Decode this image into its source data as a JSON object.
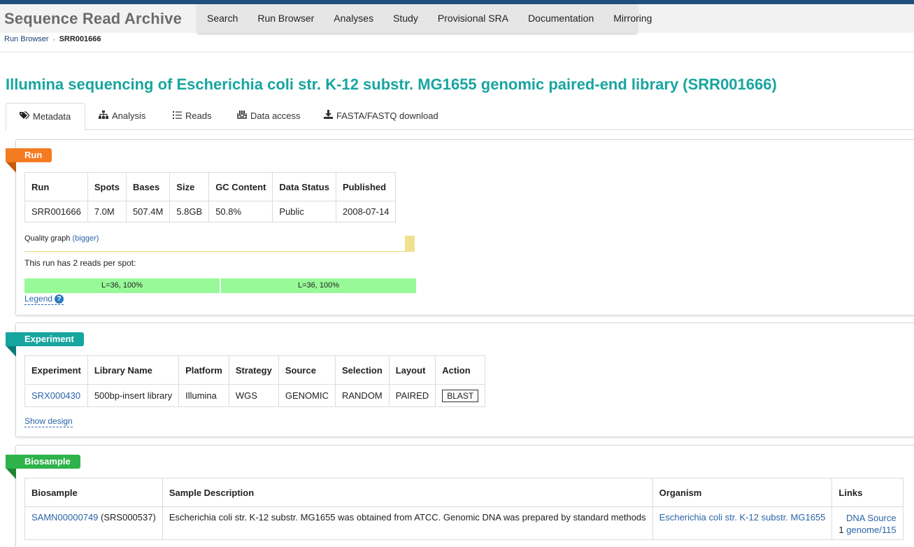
{
  "header": {
    "brand": "Sequence Read Archive",
    "nav": [
      "Search",
      "Run Browser",
      "Analyses",
      "Study",
      "Provisional SRA",
      "Documentation",
      "Mirroring"
    ]
  },
  "breadcrumb": {
    "link": "Run Browser",
    "current": "SRR001666"
  },
  "page_title": "Illumina sequencing of Escherichia coli str. K-12 substr. MG1655 genomic paired-end library (SRR001666)",
  "tabs": [
    {
      "label": "Metadata",
      "icon": "tags-icon"
    },
    {
      "label": "Analysis",
      "icon": "sitemap-icon"
    },
    {
      "label": "Reads",
      "icon": "list-icon"
    },
    {
      "label": "Data access",
      "icon": "inbox-icon"
    },
    {
      "label": "FASTA/FASTQ download",
      "icon": "download-icon"
    }
  ],
  "run": {
    "label": "Run",
    "color": "#f57b20",
    "headers": [
      "Run",
      "Spots",
      "Bases",
      "Size",
      "GC Content",
      "Data Status",
      "Published"
    ],
    "row": [
      "SRR001666",
      "7.0M",
      "507.4M",
      "5.8GB",
      "50.8%",
      "Public",
      "2008-07-14"
    ],
    "quality_label": "Quality graph",
    "quality_link": "(bigger)",
    "reads_text": "This run has 2 reads per spot:",
    "reads": [
      "L=36, 100%",
      "L=36, 100%"
    ],
    "legend": "Legend"
  },
  "experiment": {
    "label": "Experiment",
    "color": "#17a5a0",
    "headers": [
      "Experiment",
      "Library Name",
      "Platform",
      "Strategy",
      "Source",
      "Selection",
      "Layout",
      "Action"
    ],
    "row": [
      "SRX000430",
      "500bp-insert library",
      "Illumina",
      "WGS",
      "GENOMIC",
      "RANDOM",
      "PAIRED",
      "BLAST"
    ],
    "show_design": "Show design"
  },
  "biosample": {
    "label": "Biosample",
    "color": "#2db34a",
    "headers": [
      "Biosample",
      "Sample Description",
      "Organism",
      "Links"
    ],
    "biosample_id": "SAMN00000749",
    "srs_id": "(SRS000537)",
    "description": "Escherichia coli str. K-12 substr. MG1655 was obtained from ATCC. Genomic DNA was prepared by standard methods",
    "organism": "Escherichia coli str. K-12 substr. MG1655",
    "links": [
      {
        "prefix": "",
        "label": "DNA Source"
      },
      {
        "prefix": "1",
        "label": "genome/115"
      }
    ]
  }
}
